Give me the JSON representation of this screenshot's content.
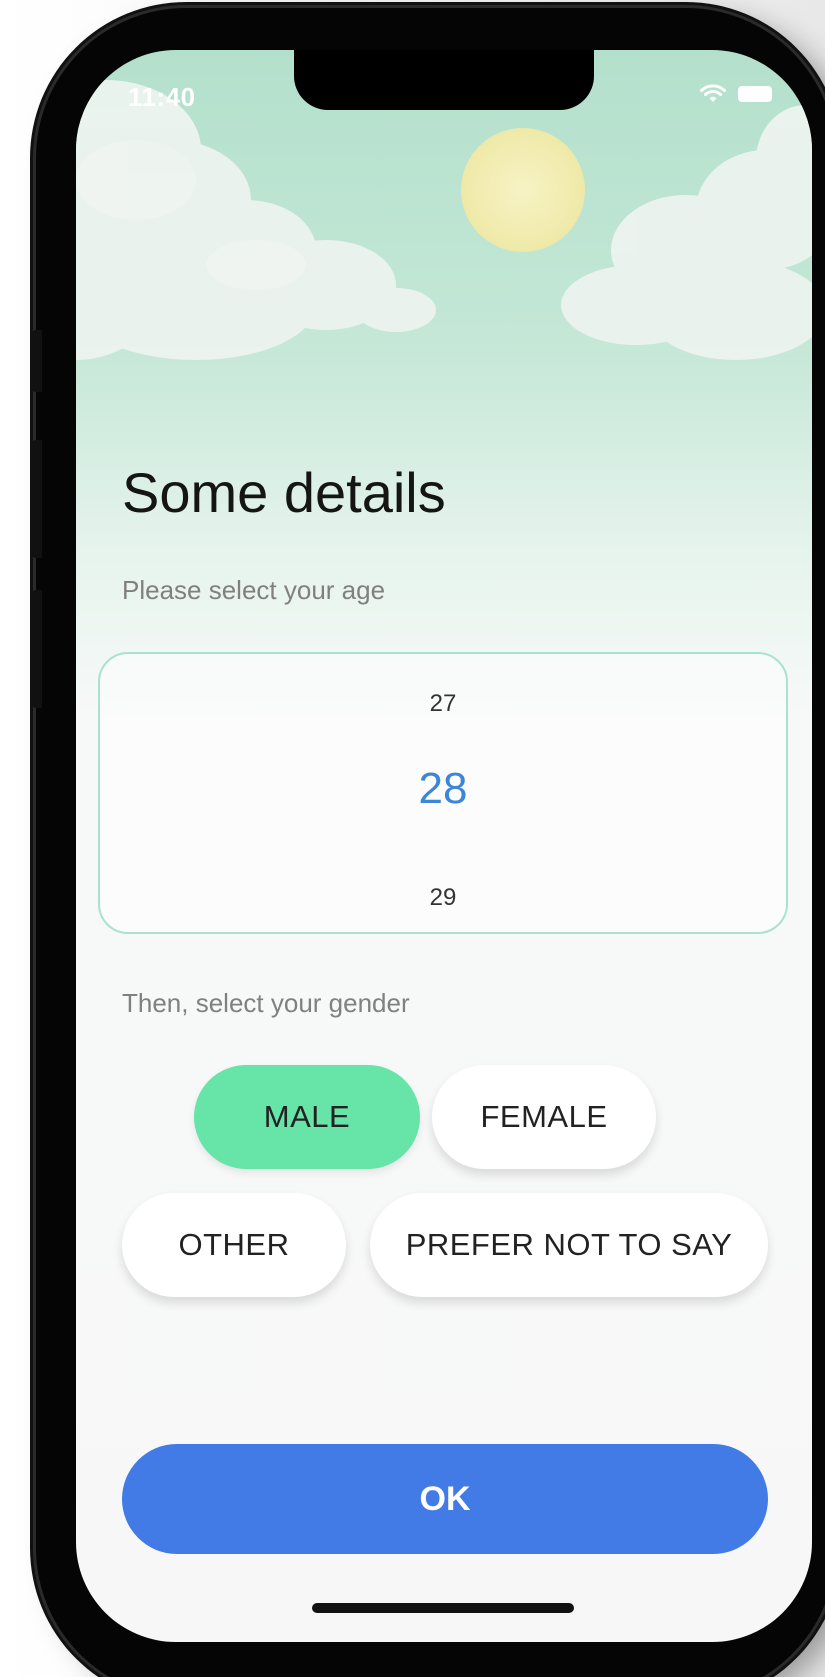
{
  "status_bar": {
    "time": "11:40",
    "icons": [
      "wifi-icon",
      "battery-icon"
    ]
  },
  "page": {
    "title": "Some details",
    "age_prompt": "Please select your age",
    "gender_prompt": "Then, select your gender"
  },
  "age_picker": {
    "previous": "27",
    "selected": "28",
    "next": "29"
  },
  "gender_options": [
    {
      "label": "MALE",
      "selected": true
    },
    {
      "label": "FEMALE",
      "selected": false
    },
    {
      "label": "OTHER",
      "selected": false
    },
    {
      "label": "PREFER NOT TO SAY",
      "selected": false
    }
  ],
  "actions": {
    "ok_label": "OK"
  },
  "colors": {
    "sky": "#b3e0cc",
    "accent_green": "#67e4a8",
    "picker_selected": "#3b86d9",
    "primary_button": "#427be6",
    "sun": "#f5f0b8"
  }
}
